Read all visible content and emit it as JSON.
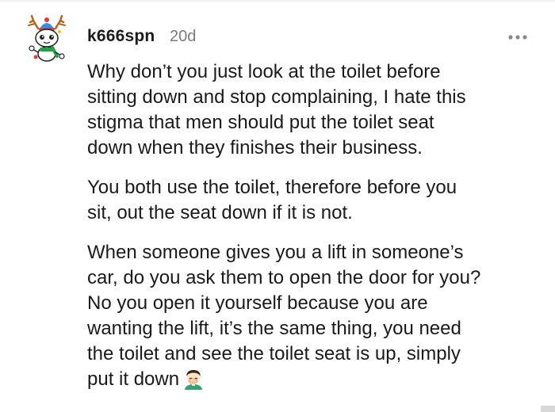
{
  "comment": {
    "author": "k666spn",
    "age": "20d",
    "avatar_icon": "reindeer-snoo-avatar-icon",
    "menu_icon": "more-options-icon",
    "paragraphs": [
      {
        "lines": [
          "Why don’t you just look at the toilet before",
          "sitting down and stop complaining, I hate this",
          "stigma that men should put the toilet seat",
          "down when they finishes their business."
        ]
      },
      {
        "lines": [
          "You both use the toilet, therefore before you",
          "sit, out the seat down if it is not."
        ]
      },
      {
        "lines": [
          "When someone gives you a lift in someone’s",
          "car, do you ask them to open the door for you?",
          "No you open it yourself because you are",
          "wanting the lift, it’s the same thing, you need",
          "the toilet and see the toilet seat is up, simply",
          "put it down"
        ],
        "trailing_emoji": "facepalm-emoji-icon"
      }
    ]
  },
  "colors": {
    "username": "#1c1c1c",
    "timestamp": "#7c7c7c",
    "body_text": "#1a1a1a",
    "menu_dots": "#878a8c"
  }
}
